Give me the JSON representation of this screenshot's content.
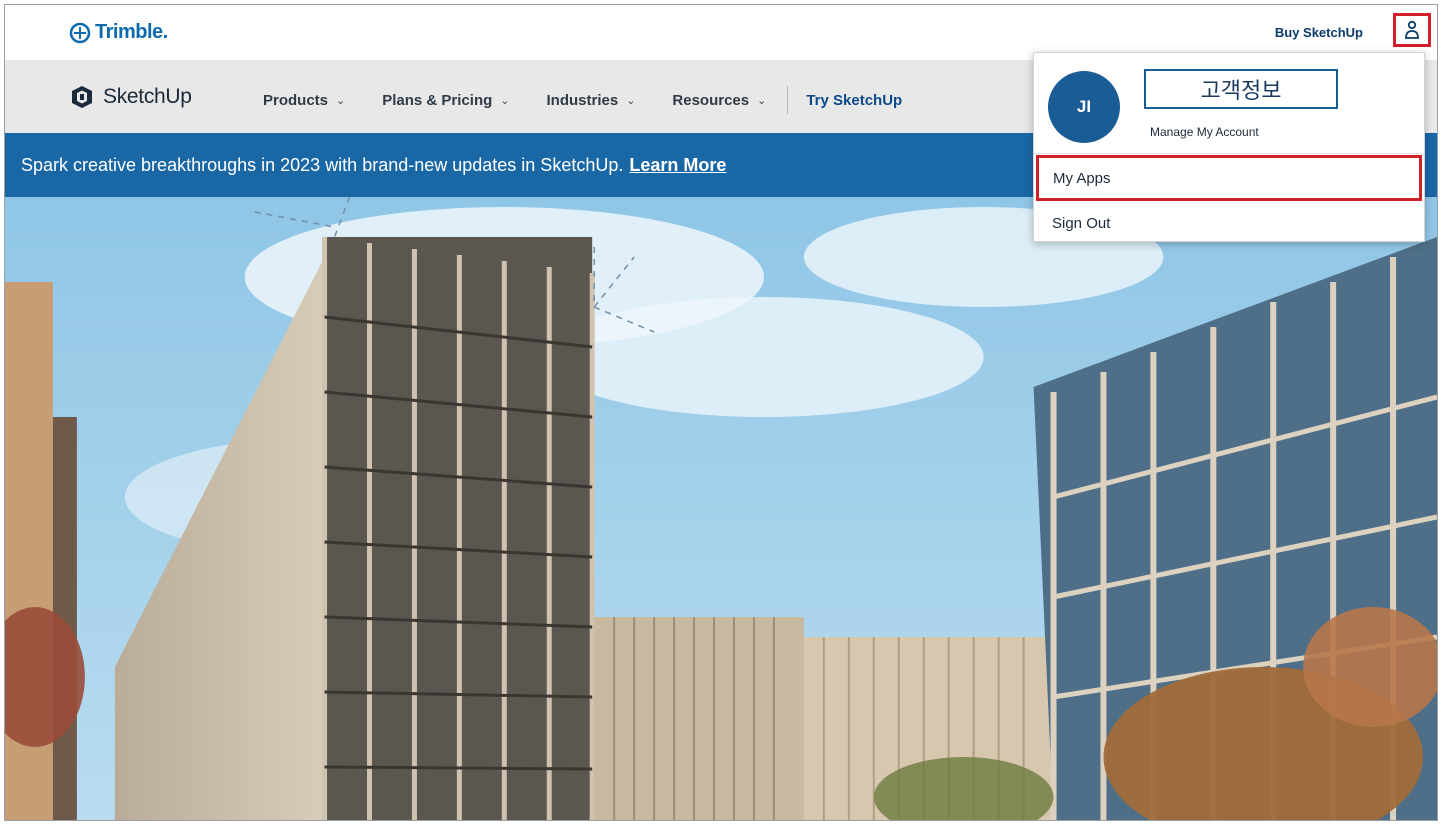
{
  "header": {
    "brand": "Trimble.",
    "buy_label": "Buy SketchUp"
  },
  "nav": {
    "logo_text": "SketchUp",
    "items": [
      {
        "label": "Products"
      },
      {
        "label": "Plans & Pricing"
      },
      {
        "label": "Industries"
      },
      {
        "label": "Resources"
      }
    ],
    "try_label": "Try SketchUp"
  },
  "banner": {
    "message": "Spark creative breakthroughs in 2023 with brand-new updates in SketchUp.",
    "link_label": "Learn More"
  },
  "account_menu": {
    "initials": "JI",
    "annotation": "고객정보",
    "manage_label": "Manage My Account",
    "my_apps_label": "My Apps",
    "sign_out_label": "Sign Out"
  },
  "colors": {
    "brand_blue": "#1a67a6",
    "highlight_red": "#d0202a",
    "nav_bg": "#e8e8e8"
  },
  "icons": {
    "account": "user-icon",
    "dropdown": "chevron-down-icon",
    "trimble": "trimble-logo-icon",
    "sketchup": "sketchup-logo-icon"
  }
}
